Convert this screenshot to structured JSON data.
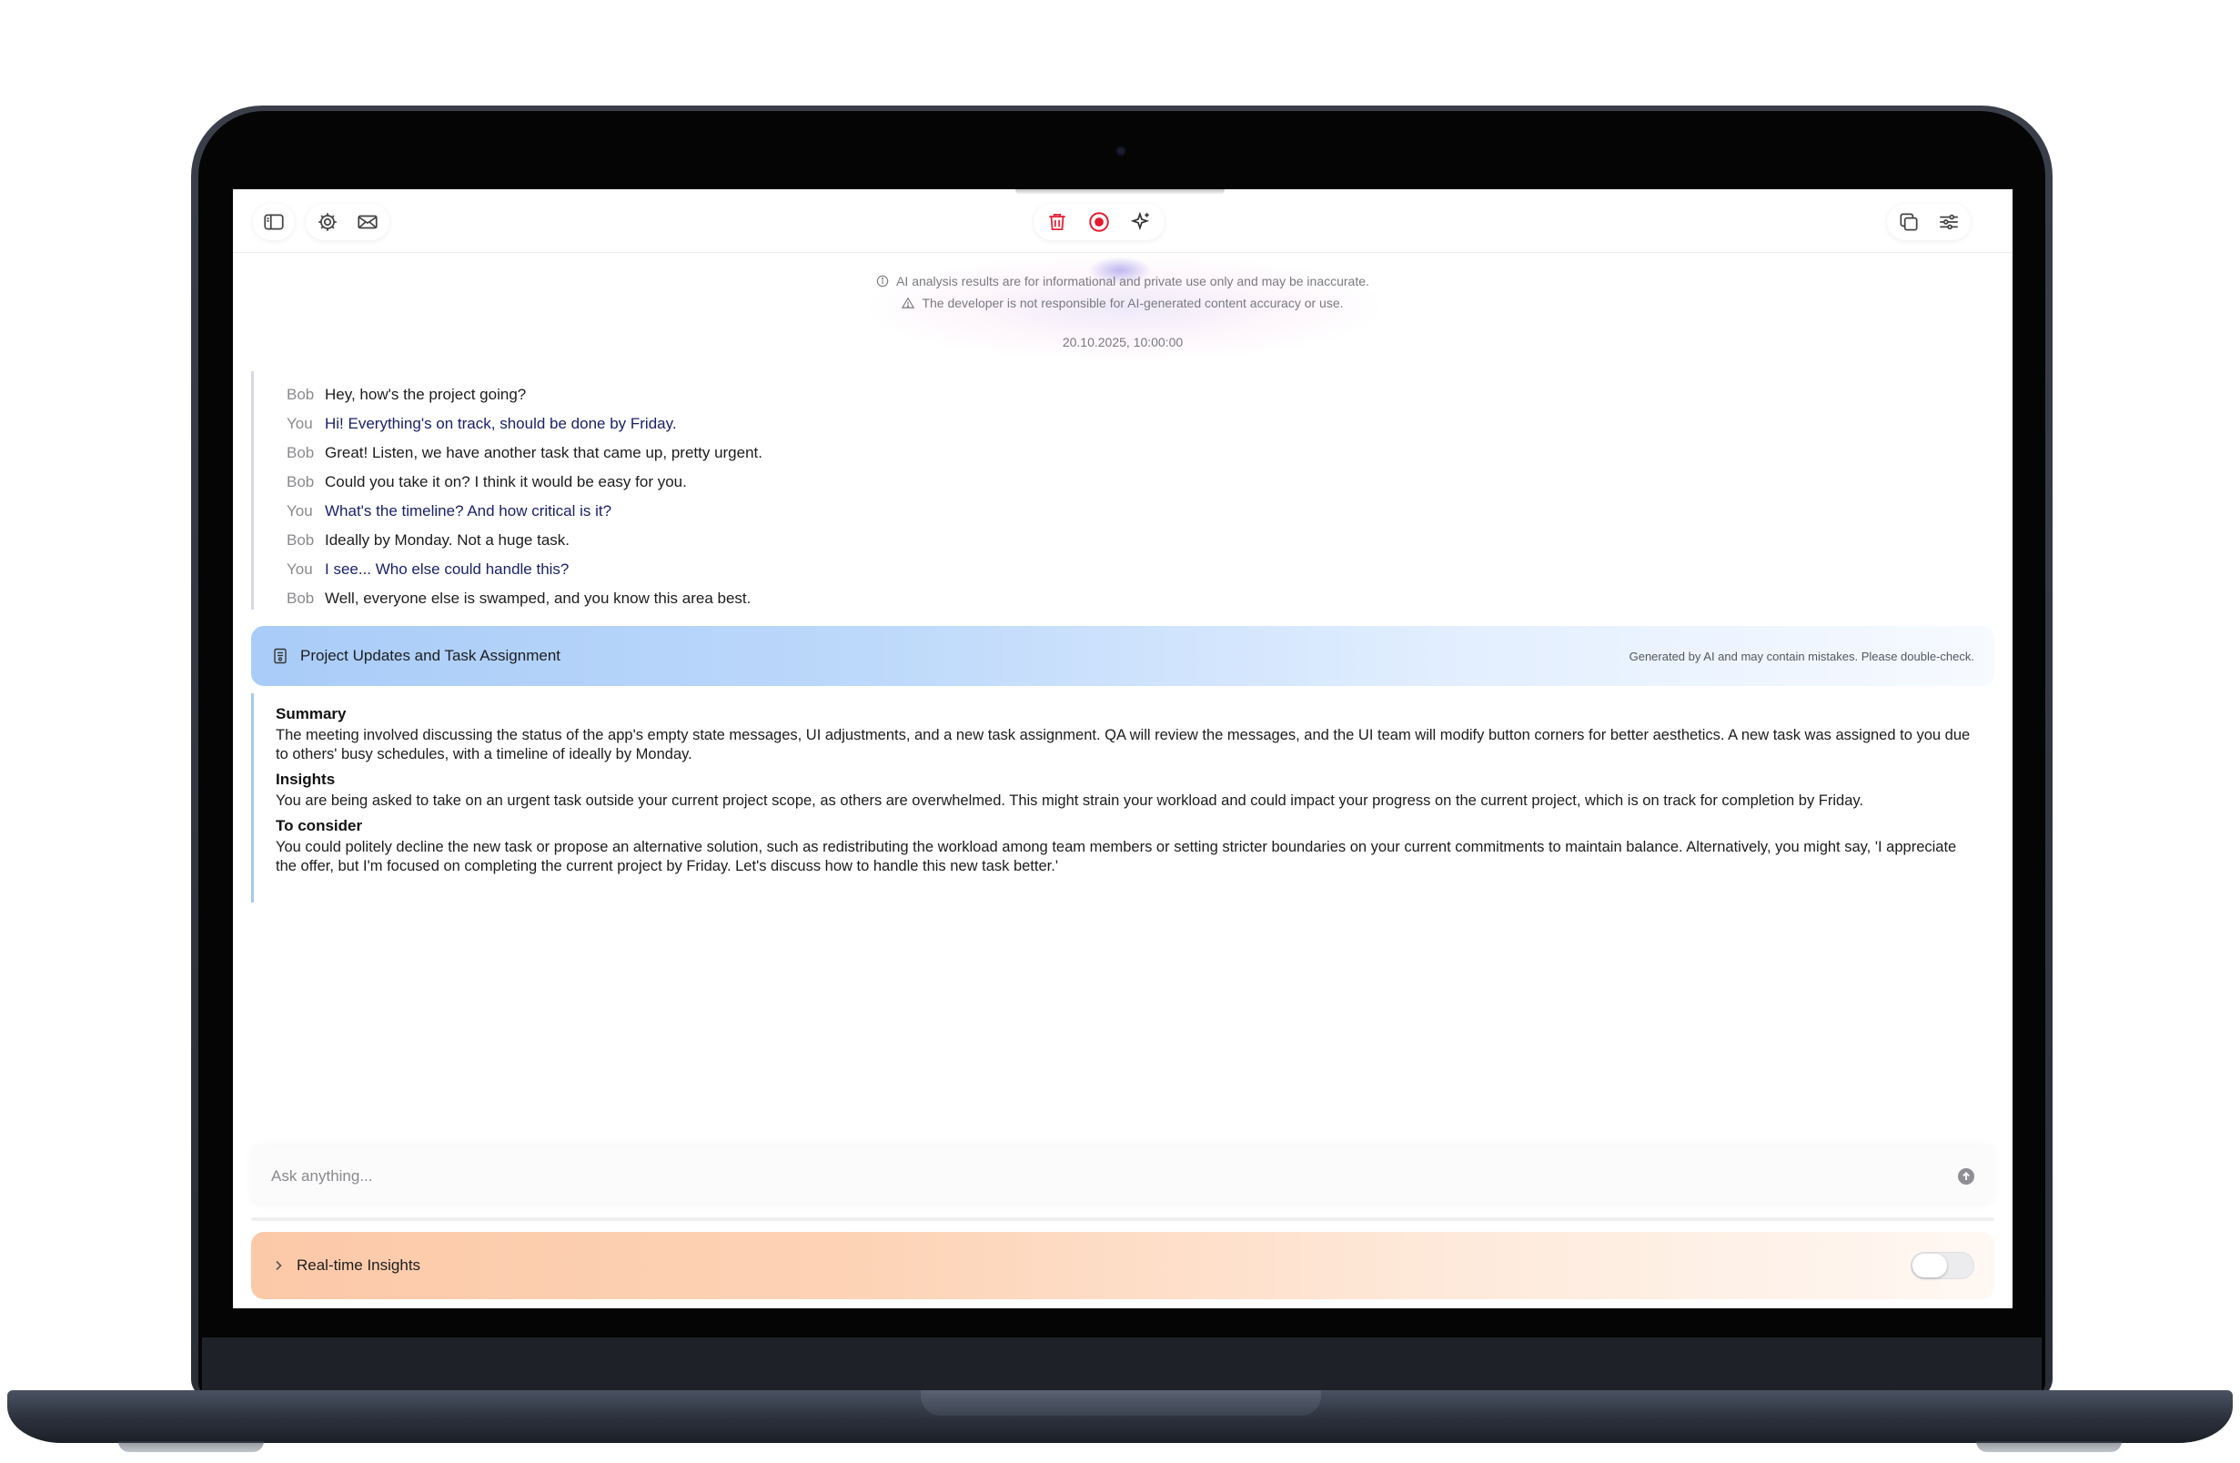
{
  "colors": {
    "trash_red": "#e5253a",
    "record_red": "#e41b2d",
    "you_text": "#1a1f6b",
    "header_blue": "#a9ccf8",
    "insights_orange": "#fcc9a8"
  },
  "toolbar": {
    "left_icons": [
      "sidebar-icon",
      "gear-icon",
      "mail-icon"
    ],
    "center_icons": [
      "trash-icon",
      "record-icon",
      "sparkle-icon"
    ],
    "right_icons": [
      "copy-icon",
      "sliders-icon"
    ]
  },
  "disclaimers": {
    "info": "AI analysis results are for informational and private use only and may be inaccurate.",
    "warning": "The developer is not responsible for AI-generated content accuracy or use."
  },
  "timestamp": "20.10.2025, 10:00:00",
  "transcript": [
    {
      "speaker": "Bob",
      "text": "Hey, how's the project going?"
    },
    {
      "speaker": "You",
      "text": "Hi! Everything's on track, should be done by Friday."
    },
    {
      "speaker": "Bob",
      "text": "Great! Listen, we have another task that came up, pretty urgent."
    },
    {
      "speaker": "Bob",
      "text": "Could you take it on? I think it would be easy for you."
    },
    {
      "speaker": "You",
      "text": "What's the timeline? And how critical is it?"
    },
    {
      "speaker": "Bob",
      "text": "Ideally by Monday. Not a huge task."
    },
    {
      "speaker": "You",
      "text": "I see... Who else could handle this?"
    },
    {
      "speaker": "Bob",
      "text": "Well, everyone else is swamped, and you know this area best."
    }
  ],
  "summary_card": {
    "title": "Project Updates and Task Assignment",
    "note": "Generated by AI and may contain mistakes. Please double-check.",
    "sections": [
      {
        "title": "Summary",
        "text": "The meeting involved discussing the status of the app's empty state messages, UI adjustments, and a new task assignment. QA will review the messages, and the UI team will modify button corners for better aesthetics. A new task was assigned to you due to others' busy schedules, with a timeline of ideally by Monday."
      },
      {
        "title": "Insights",
        "text": "You are being asked to take on an urgent task outside your current project scope, as others are overwhelmed. This might strain your workload and could impact your progress on the current project, which is on track for completion by Friday."
      },
      {
        "title": "To consider",
        "text": "You could politely decline the new task or propose an alternative solution, such as redistributing the workload among team members or setting stricter boundaries on your current commitments to maintain balance. Alternatively, you might say, 'I appreciate the offer, but I'm focused on completing the current project by Friday. Let's discuss how to handle this new task better.'"
      }
    ]
  },
  "ask": {
    "placeholder": "Ask anything...",
    "value": ""
  },
  "realtime": {
    "label": "Real-time Insights",
    "enabled": false
  }
}
